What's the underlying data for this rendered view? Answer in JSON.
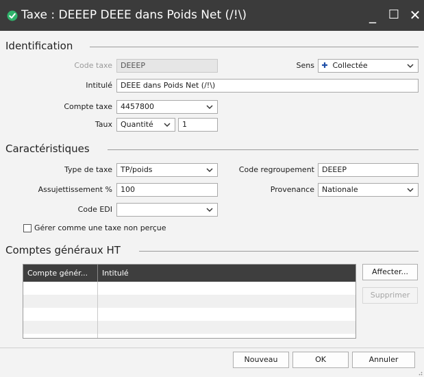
{
  "window": {
    "title": "Taxe : DEEEP DEEE dans Poids Net (/!\\)",
    "minimize_glyph": "_",
    "maximize_glyph": "☐",
    "close_glyph": "✕"
  },
  "identification": {
    "section_title": "Identification",
    "code_taxe_label": "Code taxe",
    "code_taxe_value": "DEEEP",
    "sens_label": "Sens",
    "sens_value": "Collectée",
    "sens_icon": "plus-icon",
    "intitule_label": "Intitulé",
    "intitule_value": "DEEE dans Poids Net (/!\\)",
    "compte_taxe_label": "Compte taxe",
    "compte_taxe_value": "4457800",
    "taux_label": "Taux",
    "taux_type_value": "Quantité",
    "taux_value": "1"
  },
  "caracteristiques": {
    "section_title": "Caractéristiques",
    "type_taxe_label": "Type de taxe",
    "type_taxe_value": "TP/poids",
    "code_regroupement_label": "Code regroupement",
    "code_regroupement_value": "DEEEP",
    "assujettissement_label": "Assujettissement %",
    "assujettissement_value": "100",
    "provenance_label": "Provenance",
    "provenance_value": "Nationale",
    "code_edi_label": "Code EDI",
    "code_edi_value": "",
    "gerer_checkbox_label": "Gérer comme une taxe non perçue",
    "gerer_checked": false
  },
  "comptes": {
    "section_title": "Comptes généraux HT",
    "columns": [
      "Compte génér...",
      "Intitulé"
    ],
    "rows": [],
    "affecter_label": "Affecter...",
    "supprimer_label": "Supprimer"
  },
  "footer": {
    "nouveau_label": "Nouveau",
    "ok_label": "OK",
    "annuler_label": "Annuler"
  },
  "colors": {
    "titlebar": "#3b3b3b",
    "dialog_bg": "#f3f3f3",
    "grid_header": "#3e3e3e",
    "app_icon": "#2fb36b",
    "sens_plus": "#1f4fa8"
  }
}
